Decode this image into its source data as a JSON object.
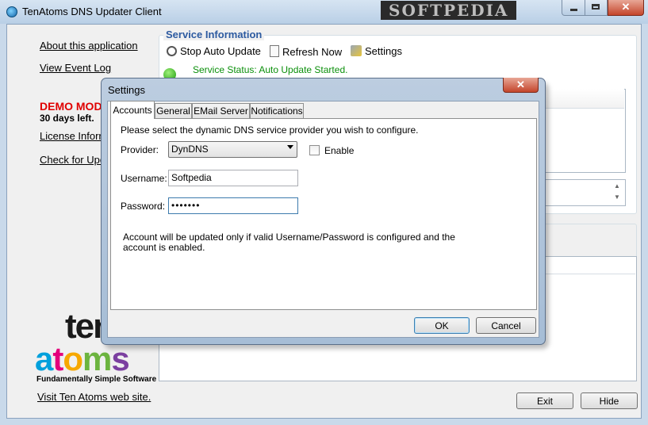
{
  "window": {
    "title": "TenAtoms DNS Updater Client",
    "watermark": "SOFTPEDIA",
    "close_glyph": "✕"
  },
  "sidebar": {
    "about_link": "About this application",
    "event_log_link": "View Event Log",
    "demo_mode": "DEMO MODE",
    "days_left": "30 days left.",
    "license_link": "License Information",
    "update_link": "Check for Updates",
    "logo_ten": "ten",
    "logo_atoms": "atoms",
    "logo_tagline": "Fundamentally Simple Software",
    "visit_link": "Visit Ten Atoms web site."
  },
  "service": {
    "title": "Service Information",
    "stop_label": "Stop Auto Update",
    "refresh_label": "Refresh Now",
    "settings_label": "Settings",
    "status_text": "Service Status: Auto Update Started.",
    "status_color": "#0a8f0a"
  },
  "buttons": {
    "exit_label": "Exit",
    "hide_label": "Hide"
  },
  "dialog": {
    "title": "Settings",
    "close_glyph": "✕",
    "tabs": [
      {
        "label": "Accounts",
        "selected": true
      },
      {
        "label": "General"
      },
      {
        "label": "EMail Server"
      },
      {
        "label": "Notifications"
      }
    ],
    "instruction": "Please select the dynamic DNS service provider you wish to configure.",
    "provider_label": "Provider:",
    "provider_value": "DynDNS",
    "enable_label": "Enable",
    "enable_checked": false,
    "username_label": "Username:",
    "username_value": "Softpedia",
    "password_label": "Password:",
    "password_value": "•••••••",
    "note": "Account will be updated only if valid Username/Password is configured and the account is enabled.",
    "ok_label": "OK",
    "cancel_label": "Cancel"
  },
  "colors": {
    "demo_red": "#e00000",
    "section_title_blue": "#2c5aa0"
  }
}
